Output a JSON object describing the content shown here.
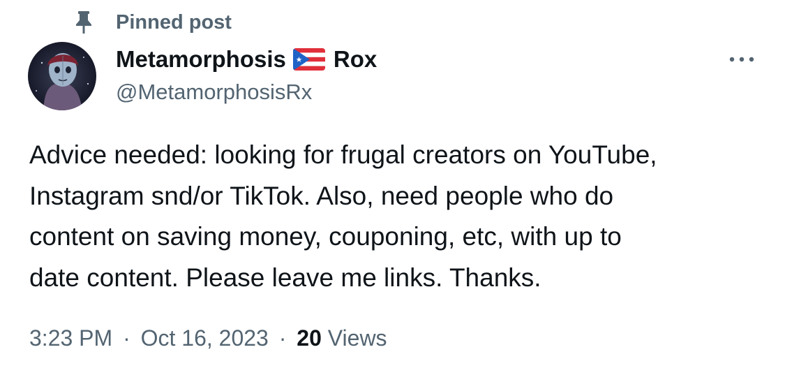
{
  "pinned": {
    "label": "Pinned post",
    "icon": "pin-icon"
  },
  "author": {
    "name_start": "Metamorphosis",
    "flag_icon": "puerto-rico-flag-icon",
    "name_end": "Rox",
    "handle": "@MetamorphosisRx",
    "avatar_icon": "avatar"
  },
  "more_icon": "more-icon",
  "post": {
    "lines": [
      "Advice needed: looking for frugal creators on YouTube,",
      "Instagram snd/or TikTok. Also, need people who do",
      "content on saving money, couponing, etc, with up to",
      "date content. Please leave me links. Thanks."
    ]
  },
  "meta": {
    "time": "3:23 PM",
    "separator": "·",
    "date": "Oct 16, 2023",
    "views_count": "20",
    "views_label": "Views"
  },
  "colors": {
    "text": "#0f1419",
    "secondary": "#536471",
    "background": "#ffffff"
  }
}
